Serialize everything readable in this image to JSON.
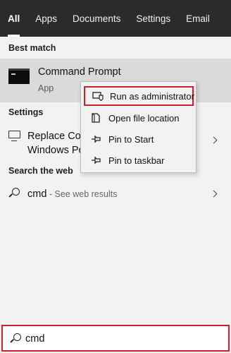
{
  "tabs": [
    {
      "label": "All",
      "active": true
    },
    {
      "label": "Apps"
    },
    {
      "label": "Documents"
    },
    {
      "label": "Settings"
    },
    {
      "label": "Email"
    }
  ],
  "best_match": {
    "header": "Best match",
    "title": "Command Prompt",
    "subtitle": "App",
    "icon": "command-prompt-icon"
  },
  "settings_section": {
    "header": "Settings",
    "item_line1": "Replace Command Prompt with",
    "item_line2": "Windows PowerShell",
    "icon": "display-settings-icon"
  },
  "web_section": {
    "header": "Search the web",
    "query": "cmd",
    "hint": " - See web results",
    "icon": "search-icon"
  },
  "context_menu": {
    "items": [
      {
        "label": "Run as administrator",
        "icon": "shield-admin-icon",
        "highlighted": true
      },
      {
        "label": "Open file location",
        "icon": "file-location-icon"
      },
      {
        "label": "Pin to Start",
        "icon": "pin-icon"
      },
      {
        "label": "Pin to taskbar",
        "icon": "pin-icon"
      }
    ]
  },
  "search_box": {
    "value": "cmd",
    "icon": "search-icon"
  },
  "colors": {
    "tabbar_bg": "#2b2b2b",
    "panel_bg": "#f2f2f2",
    "selected_row_bg": "#dadada",
    "highlight_border": "#c8232c"
  }
}
